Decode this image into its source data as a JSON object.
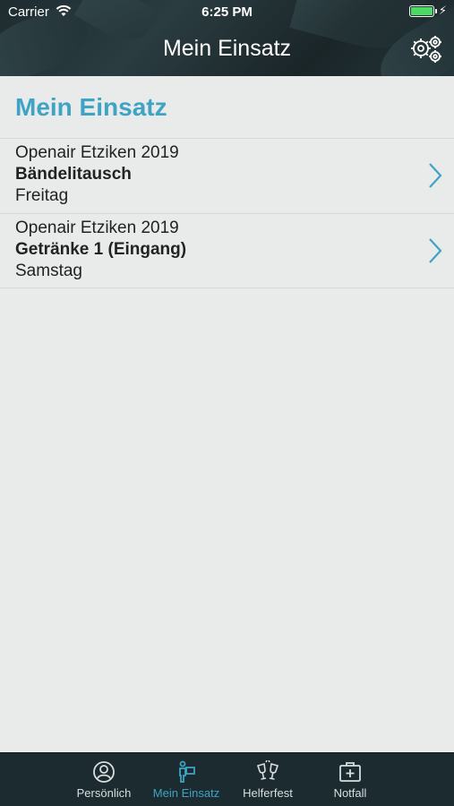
{
  "status_bar": {
    "carrier": "Carrier",
    "time": "6:25 PM"
  },
  "header": {
    "title": "Mein Einsatz",
    "settings_icon": "gears-icon"
  },
  "section": {
    "title": "Mein Einsatz"
  },
  "items": [
    {
      "event": "Openair Etziken 2019",
      "task": "Bändelitausch",
      "day": "Freitag"
    },
    {
      "event": "Openair Etziken 2019",
      "task": "Getränke 1 (Eingang)",
      "day": "Samstag"
    }
  ],
  "tabs": [
    {
      "label": "Persönlich",
      "icon": "person-icon",
      "active": false
    },
    {
      "label": "Mein Einsatz",
      "icon": "worker-icon",
      "active": true
    },
    {
      "label": "Helferfest",
      "icon": "cheers-icon",
      "active": false
    },
    {
      "label": "Notfall",
      "icon": "first-aid-icon",
      "active": false
    }
  ],
  "colors": {
    "accent": "#3ea3c5",
    "header_bg": "#1e2c30",
    "tabbar_bg": "#1c2b2f",
    "background": "#e9ebea"
  }
}
